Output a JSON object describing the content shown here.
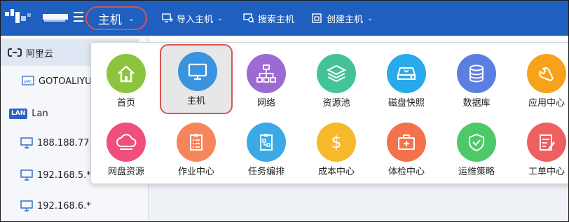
{
  "topbar": {
    "main_menu_label": "主机",
    "items": [
      {
        "label": "导入主机",
        "icon": "import-host-icon",
        "has_dropdown": true
      },
      {
        "label": "搜索主机",
        "icon": "search-host-icon",
        "has_dropdown": false
      },
      {
        "label": "创建主机",
        "icon": "create-host-icon",
        "has_dropdown": true
      }
    ]
  },
  "sidebar": {
    "items": [
      {
        "label": "阿里云",
        "icon": "aliyun-icon",
        "active": true
      },
      {
        "label": "GOTOALIYU",
        "icon": "vpc-icon",
        "badge": "VPC"
      },
      {
        "label": "Lan",
        "icon": "lan-icon",
        "badge": "LAN"
      },
      {
        "label": "188.188.77.",
        "icon": "monitor-icon"
      },
      {
        "label": "192.168.5.*",
        "icon": "monitor-icon"
      },
      {
        "label": "192.168.6.*",
        "icon": "monitor-icon"
      }
    ]
  },
  "menu": {
    "tiles": [
      {
        "label": "首页",
        "icon": "home-icon",
        "color": "#8cc43f"
      },
      {
        "label": "主机",
        "icon": "monitor-icon",
        "color": "#3b93e0",
        "selected": true
      },
      {
        "label": "网络",
        "icon": "network-icon",
        "color": "#9b6bd2"
      },
      {
        "label": "资源池",
        "icon": "layers-icon",
        "color": "#44c29a"
      },
      {
        "label": "磁盘快照",
        "icon": "disk-icon",
        "color": "#29a9ea"
      },
      {
        "label": "数据库",
        "icon": "database-icon",
        "color": "#5b7fe0"
      },
      {
        "label": "应用中心",
        "icon": "wrench-icon",
        "color": "#f7a21b"
      },
      {
        "label": "网盘资源",
        "icon": "cloud-icon",
        "color": "#ef4f7a"
      },
      {
        "label": "作业中心",
        "icon": "checklist-icon",
        "color": "#f7855c"
      },
      {
        "label": "任务编排",
        "icon": "flow-icon",
        "color": "#3aa9e6"
      },
      {
        "label": "成本中心",
        "icon": "dollar-icon",
        "color": "#f6b92b"
      },
      {
        "label": "体检中心",
        "icon": "medkit-icon",
        "color": "#f2724b"
      },
      {
        "label": "运维策略",
        "icon": "shield-icon",
        "color": "#4ec96a"
      },
      {
        "label": "工单中心",
        "icon": "ticket-icon",
        "color": "#ef5f5f"
      }
    ]
  }
}
